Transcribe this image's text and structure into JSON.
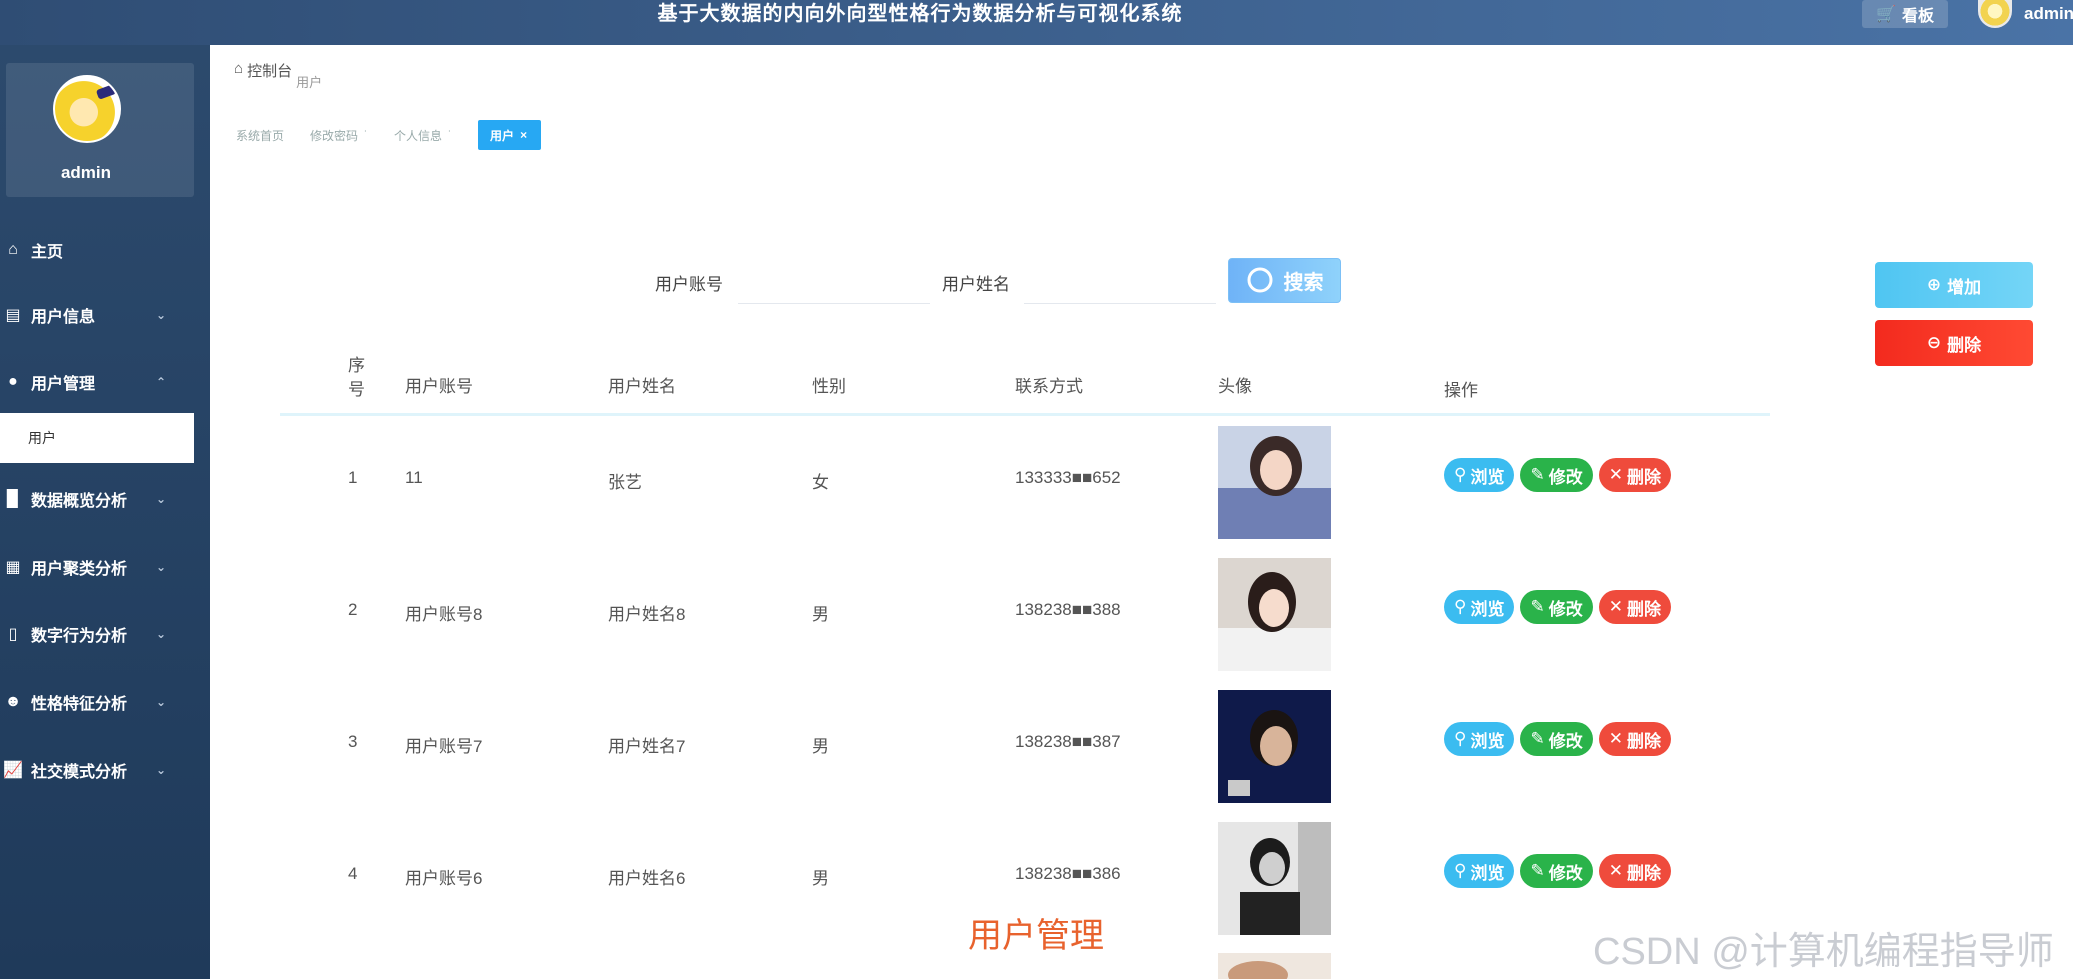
{
  "header": {
    "title": "基于大数据的内向外向型性格行为数据分析与可视化系统",
    "board_label": "看板",
    "user": "admin"
  },
  "sidebar": {
    "profile_name": "admin",
    "items": [
      {
        "label": "主页",
        "icon": "home-icon"
      },
      {
        "label": "用户信息",
        "icon": "card-icon"
      },
      {
        "label": "用户管理",
        "icon": "user-icon"
      },
      {
        "label": "数据概览分析",
        "icon": "bar-chart-icon"
      },
      {
        "label": "用户聚类分析",
        "icon": "grid-icon"
      },
      {
        "label": "数字行为分析",
        "icon": "phone-icon"
      },
      {
        "label": "性格特征分析",
        "icon": "person-icon"
      },
      {
        "label": "社交模式分析",
        "icon": "line-chart-icon"
      }
    ],
    "sub_item": "用户"
  },
  "breadcrumb": {
    "root": "控制台",
    "current": "用户"
  },
  "tabs": [
    {
      "label": "系统首页"
    },
    {
      "label": "修改密码"
    },
    {
      "label": "个人信息"
    },
    {
      "label": "用户",
      "active": true
    }
  ],
  "search": {
    "account_label": "用户账号",
    "account_value": "",
    "name_label": "用户姓名",
    "name_value": "",
    "button": "搜索"
  },
  "actions": {
    "add": "增加",
    "delete": "删除"
  },
  "table": {
    "headers": [
      "序号",
      "用户账号",
      "用户姓名",
      "性别",
      "联系方式",
      "头像",
      "操作"
    ],
    "rows": [
      {
        "idx": "1",
        "account": "11",
        "name": "张艺",
        "gender": "女",
        "phone": "133333■■652"
      },
      {
        "idx": "2",
        "account": "用户账号8",
        "name": "用户姓名8",
        "gender": "男",
        "phone": "138238■■388"
      },
      {
        "idx": "3",
        "account": "用户账号7",
        "name": "用户姓名7",
        "gender": "男",
        "phone": "138238■■387"
      },
      {
        "idx": "4",
        "account": "用户账号6",
        "name": "用户姓名6",
        "gender": "男",
        "phone": "138238■■386"
      }
    ],
    "ops": {
      "view": "浏览",
      "edit": "修改",
      "del": "删除"
    }
  },
  "caption": "用户管理",
  "watermark": "CSDN @计算机编程指导师"
}
